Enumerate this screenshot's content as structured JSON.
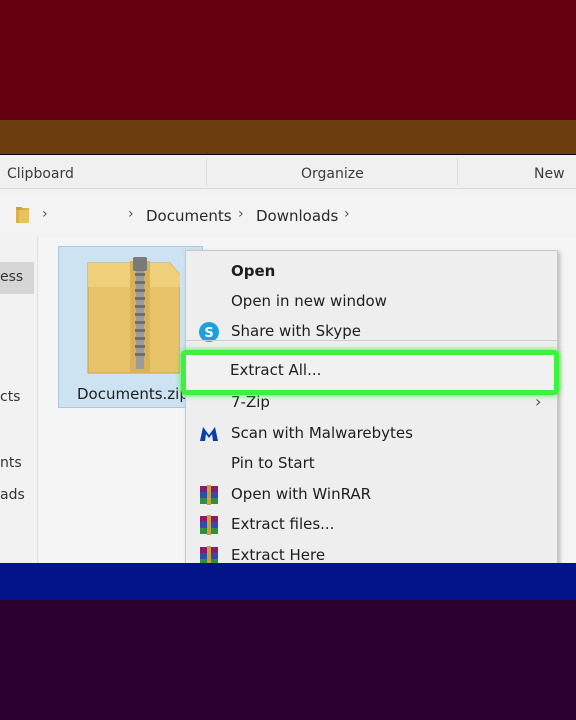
{
  "colors": {
    "band_top": "#640010",
    "band_brown": "#6a3c0e",
    "band_blue": "#03148a",
    "band_bottom": "#2c0030",
    "highlight": "#3cf23c",
    "selection": "#cde3f1"
  },
  "ribbon": {
    "groups": [
      "Clipboard",
      "Organize",
      "New"
    ]
  },
  "address_bar": {
    "icon": "folder-icon",
    "crumbs": [
      "Documents",
      "Downloads"
    ]
  },
  "nav_pane": {
    "items": [
      "ess",
      "cts",
      "nts",
      "ads"
    ]
  },
  "file": {
    "name": "Documents.zip",
    "icon": "zip-folder-icon"
  },
  "context_menu": {
    "items": [
      {
        "label": "Open",
        "icon": ""
      },
      {
        "label": "Open in new window",
        "icon": ""
      },
      {
        "label": "Share with Skype",
        "icon": "skype-icon"
      },
      {
        "label": "Extract All...",
        "icon": "",
        "highlighted": true
      },
      {
        "label": "7-Zip",
        "icon": "",
        "submenu": true
      },
      {
        "label": "Scan with Malwarebytes",
        "icon": "malwarebytes-icon"
      },
      {
        "label": "Pin to Start",
        "icon": ""
      },
      {
        "label": "Open with WinRAR",
        "icon": "winrar-icon"
      },
      {
        "label": "Extract files...",
        "icon": "winrar-icon"
      },
      {
        "label": "Extract Here",
        "icon": "winrar-icon"
      }
    ]
  }
}
